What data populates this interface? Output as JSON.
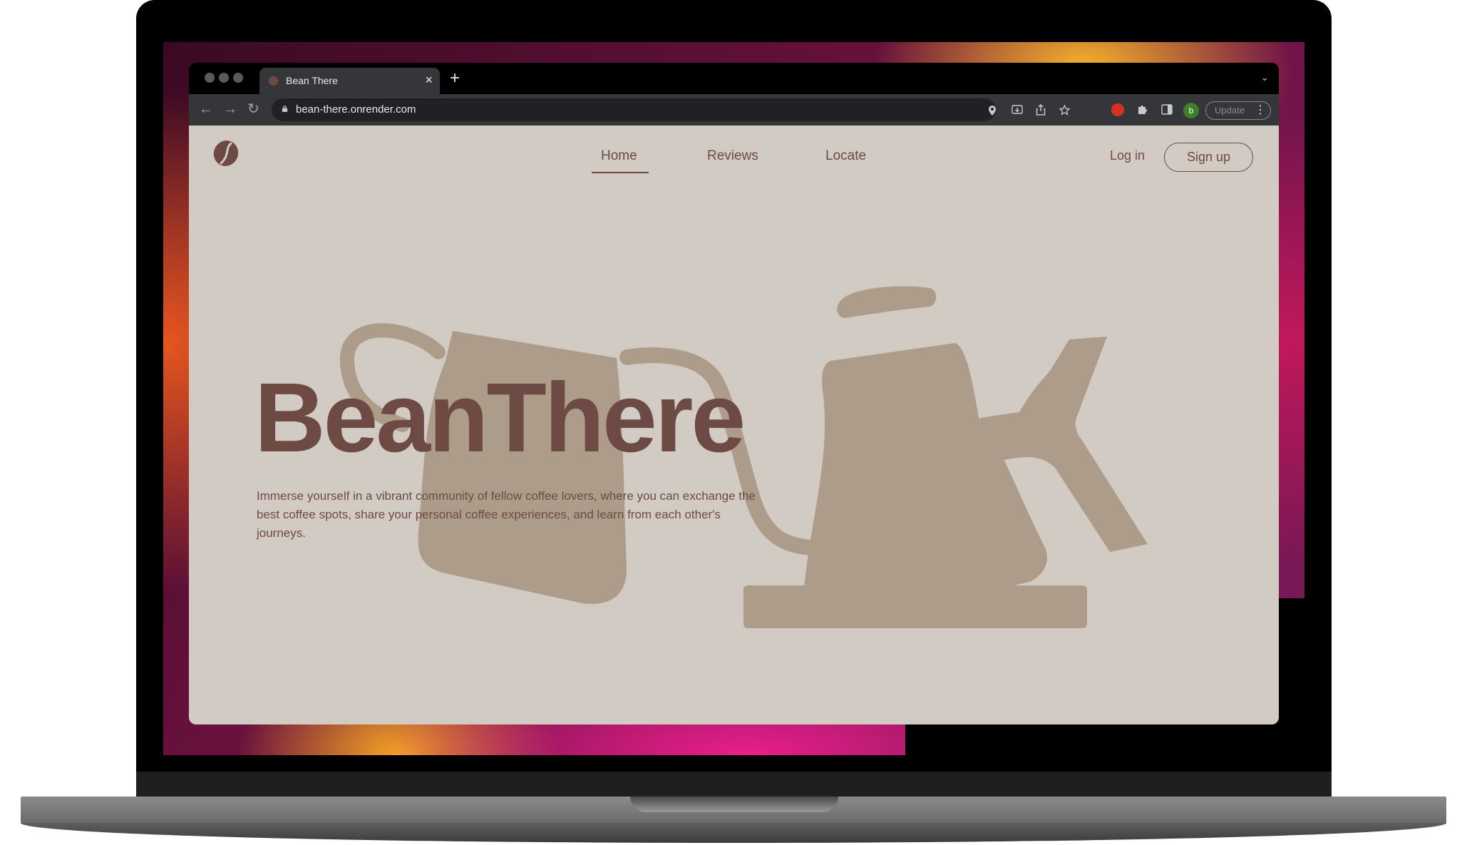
{
  "browser": {
    "tab_title": "Bean There",
    "tab_close": "×",
    "new_tab": "+",
    "tab_list": "⌄",
    "url": "bean-there.onrender.com",
    "profile_initial": "b",
    "update_label": "Update",
    "menu": "⋮",
    "nav": {
      "back": "←",
      "forward": "→",
      "reload": "↻"
    }
  },
  "site": {
    "nav": [
      {
        "label": "Home",
        "active": true
      },
      {
        "label": "Reviews",
        "active": false
      },
      {
        "label": "Locate",
        "active": false
      }
    ],
    "login_label": "Log in",
    "signup_label": "Sign up",
    "hero_title": "BeanThere",
    "hero_description": "Immerse yourself in a vibrant community of fellow coffee lovers, where you can exchange the best coffee spots, share your personal coffee experiences, and learn from each other's journeys."
  },
  "colors": {
    "page_bg": "#d1cbc4",
    "brand": "#6e4a44",
    "illustration": "#ad9c89"
  },
  "icons": {
    "logo": "coffee-bean-icon",
    "illustration": "gooseneck-kettle-and-pitcher"
  }
}
